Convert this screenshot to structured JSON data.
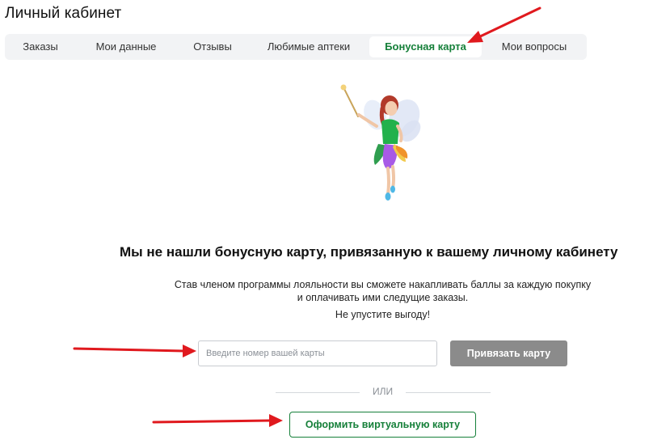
{
  "page": {
    "title": "Личный кабинет"
  },
  "tabs": [
    {
      "label": "Заказы",
      "active": false
    },
    {
      "label": "Мои данные",
      "active": false
    },
    {
      "label": "Отзывы",
      "active": false
    },
    {
      "label": "Любимые аптеки",
      "active": false
    },
    {
      "label": "Бонусная карта",
      "active": true
    },
    {
      "label": "Мои вопросы",
      "active": false
    }
  ],
  "empty_state": {
    "image_icon": "fairy-illustration",
    "headline": "Мы не нашли бонусную карту, привязанную к вашему личному кабинету",
    "desc_line1": "Став членом программы лояльности вы сможете накапливать баллы за каждую покупку",
    "desc_line2": "и оплачивать ими следущие заказы.",
    "desc_line3": "Не упустите выгоду!"
  },
  "card_form": {
    "input_placeholder": "Введите номер вашей карты",
    "input_value": "",
    "bind_button_label": "Привязать карту",
    "or_label": "ИЛИ",
    "virtual_button_label": "Оформить виртуальную карту"
  },
  "colors": {
    "accent_green": "#16803a",
    "button_gray": "#8b8b8b",
    "tabs_background": "#f2f3f5",
    "annotation_red": "#e0191e"
  }
}
